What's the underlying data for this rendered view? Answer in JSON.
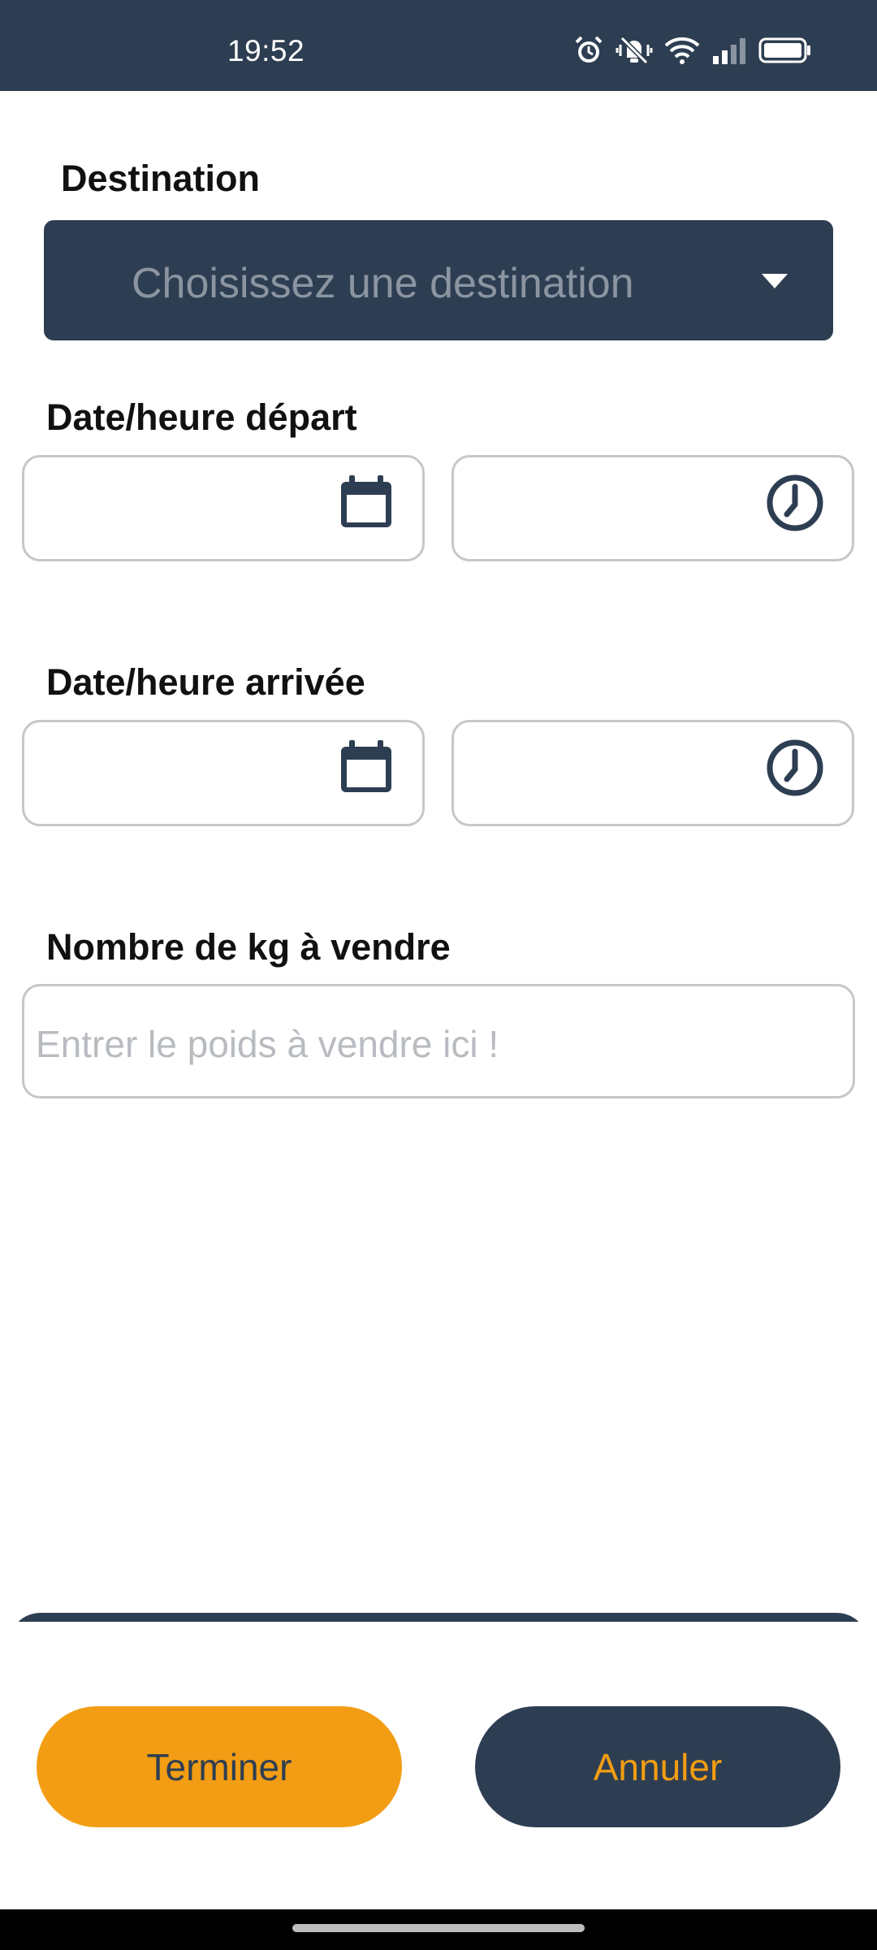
{
  "status_bar": {
    "time": "19:52",
    "icons": [
      "alarm-icon",
      "mute-vibrate-icon",
      "wifi-icon",
      "signal-icon",
      "battery-icon"
    ]
  },
  "form": {
    "destination": {
      "label": "Destination",
      "placeholder": "Choisissez une destination"
    },
    "departure": {
      "label": "Date/heure départ"
    },
    "arrival": {
      "label": "Date/heure arrivée"
    },
    "weight": {
      "label": "Nombre de kg à vendre",
      "placeholder": "Entrer le poids à vendre ici !"
    }
  },
  "actions": {
    "finish_label": "Terminer",
    "cancel_label": "Annuler"
  },
  "colors": {
    "primary_dark": "#2e3e52",
    "accent_orange": "#f29d13",
    "border_gray": "#c7c7c7"
  }
}
